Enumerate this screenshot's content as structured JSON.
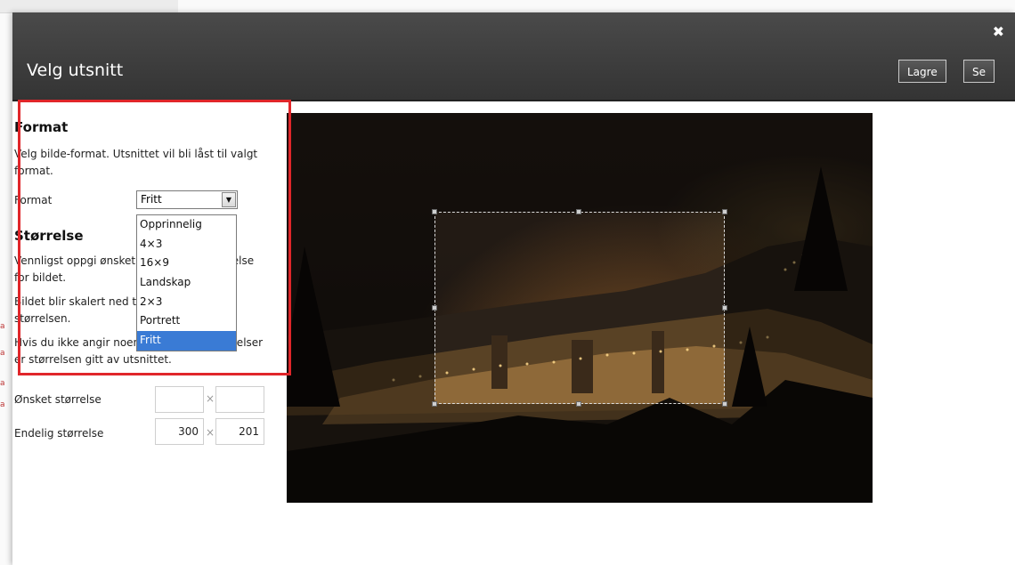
{
  "dialog": {
    "title": "Velg utsnitt",
    "save_label": "Lagre",
    "view_label": "Se",
    "close_icon": "close-icon"
  },
  "format_section": {
    "heading": "Format",
    "description": "Velg bilde-format. Utsnittet vil bli låst til valgt format.",
    "field_label": "Format",
    "selected_value": "Fritt",
    "options": [
      "Opprinnelig",
      "4×3",
      "16×9",
      "Landskap",
      "2×3",
      "Portrett",
      "Fritt"
    ]
  },
  "size_section": {
    "heading": "Størrelse",
    "text1": "Vennligst oppgi ønsket maksimums-størrelse for bildet.",
    "text2": "Bildet blir skalert ned til maksimums-størrelsen.",
    "text3": "Hvis du ikke angir noen maksimums-størrelser er størrelsen gitt av utsnittet.",
    "wanted_label": "Ønsket størrelse",
    "wanted_width": "",
    "wanted_height": "",
    "final_label": "Endelig størrelse",
    "final_width": "300",
    "final_height": "201",
    "times_symbol": "×"
  },
  "colors": {
    "header_bg": "#3c3c3c",
    "highlight": "#e0262a",
    "selected_option": "#3a7bd5"
  }
}
